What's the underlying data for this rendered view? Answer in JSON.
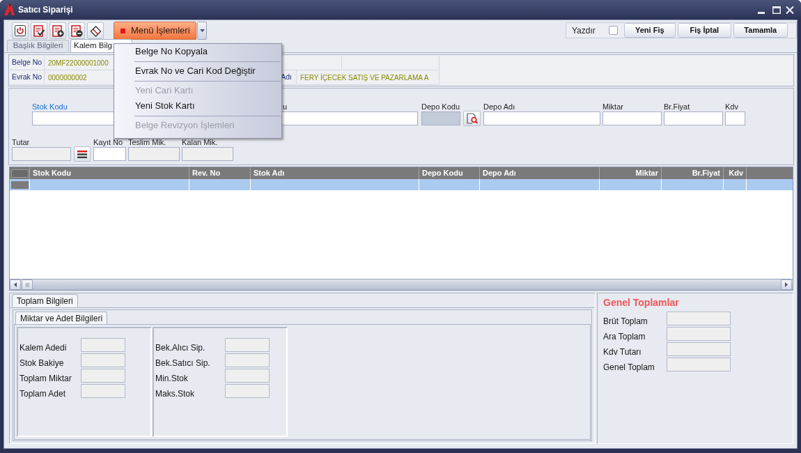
{
  "window": {
    "title": "Satıcı Siparişi"
  },
  "toolbar": {
    "menu_button": {
      "label": "Menü İşlemleri",
      "expanded": true
    },
    "print": {
      "label": "Yazdır",
      "checked": false
    },
    "buttons": [
      "Yeni Fiş",
      "Fiş İptal",
      "Tamamla"
    ]
  },
  "menu": {
    "items": [
      {
        "kind": "item",
        "label": "Belge No Kopyala",
        "disabled": false
      },
      {
        "kind": "separator"
      },
      {
        "kind": "item",
        "label": "Evrak No ve Cari Kod Değiştir",
        "disabled": false
      },
      {
        "kind": "separator"
      },
      {
        "kind": "item",
        "label": "Yeni Cari Kartı",
        "disabled": true
      },
      {
        "kind": "item",
        "label": "Yeni Stok Kartı",
        "disabled": false
      },
      {
        "kind": "separator"
      },
      {
        "kind": "item",
        "label": "Belge Revizyon İşlemleri",
        "disabled": true
      }
    ]
  },
  "tabs": [
    {
      "label": "Başlık Bilgileri",
      "selected": false
    },
    {
      "label": "Kalem Bilg",
      "selected": true
    }
  ],
  "header_info": {
    "rows": [
      {
        "cells": [
          {
            "label": "Belge No",
            "value": "20MF22000001000"
          }
        ]
      },
      {
        "cells": [
          {
            "label": "Evrak No",
            "value": "0000000002"
          },
          {
            "label": "Adı",
            "value": "FERY İÇECEK SATIŞ VE PAZARLAMA A"
          }
        ]
      }
    ]
  },
  "item_form": {
    "rows": [
      [
        {
          "label": "Stok Kodu",
          "kind": "link",
          "readonly": false
        },
        {
          "label": "u",
          "kind": "text",
          "readonly": false
        },
        {
          "label": "Depo Kodu",
          "kind": "lookup",
          "readonly": true
        },
        {
          "label": "Depo Adı",
          "kind": "text",
          "readonly": false
        },
        {
          "label": "Miktar",
          "kind": "text",
          "readonly": false
        },
        {
          "label": "Br.Fiyat",
          "kind": "text",
          "readonly": false
        },
        {
          "label": "Kdv",
          "kind": "text",
          "readonly": false
        }
      ],
      [
        {
          "label": "Tutar",
          "kind": "calc",
          "readonly": true
        },
        {
          "label": "Kayıt No",
          "kind": "text",
          "readonly": false
        },
        {
          "label": "Teslim Mik.",
          "kind": "text",
          "readonly": true
        },
        {
          "label": "Kalan Mik.",
          "kind": "text",
          "readonly": true
        }
      ]
    ]
  },
  "grid": {
    "columns": [
      {
        "label": "Stok Kodu",
        "right_aligned": false
      },
      {
        "label": "Rev. No",
        "right_aligned": false
      },
      {
        "label": "Stok Adı",
        "right_aligned": false
      },
      {
        "label": "Depo Kodu",
        "right_aligned": false
      },
      {
        "label": "Depo Adı",
        "right_aligned": false
      },
      {
        "label": "Miktar",
        "right_aligned": true
      },
      {
        "label": "Br.Fiyat",
        "right_aligned": true
      },
      {
        "label": "Kdv",
        "right_aligned": true
      }
    ],
    "rows": [
      {
        "selected": true
      }
    ]
  },
  "summary": {
    "tabs": [
      {
        "label": "Toplam Bilgileri",
        "selected": true
      }
    ],
    "sub_tabs": [
      {
        "label": "Miktar ve Adet Bilgileri",
        "selected": true
      }
    ],
    "groups": [
      {
        "fields": [
          "Kalem Adedi",
          "Stok Bakiye",
          "Toplam Miktar",
          "Toplam Adet"
        ]
      },
      {
        "fields": [
          "Bek.Alıcı Sip.",
          "Bek.Satıcı Sip.",
          "Min.Stok",
          "Maks.Stok"
        ]
      }
    ]
  },
  "totals": {
    "title": "Genel Toplamlar",
    "fields": [
      "Brüt Toplam",
      "Ara Toplam",
      "Kdv Tutarı",
      "Genel Toplam"
    ]
  }
}
